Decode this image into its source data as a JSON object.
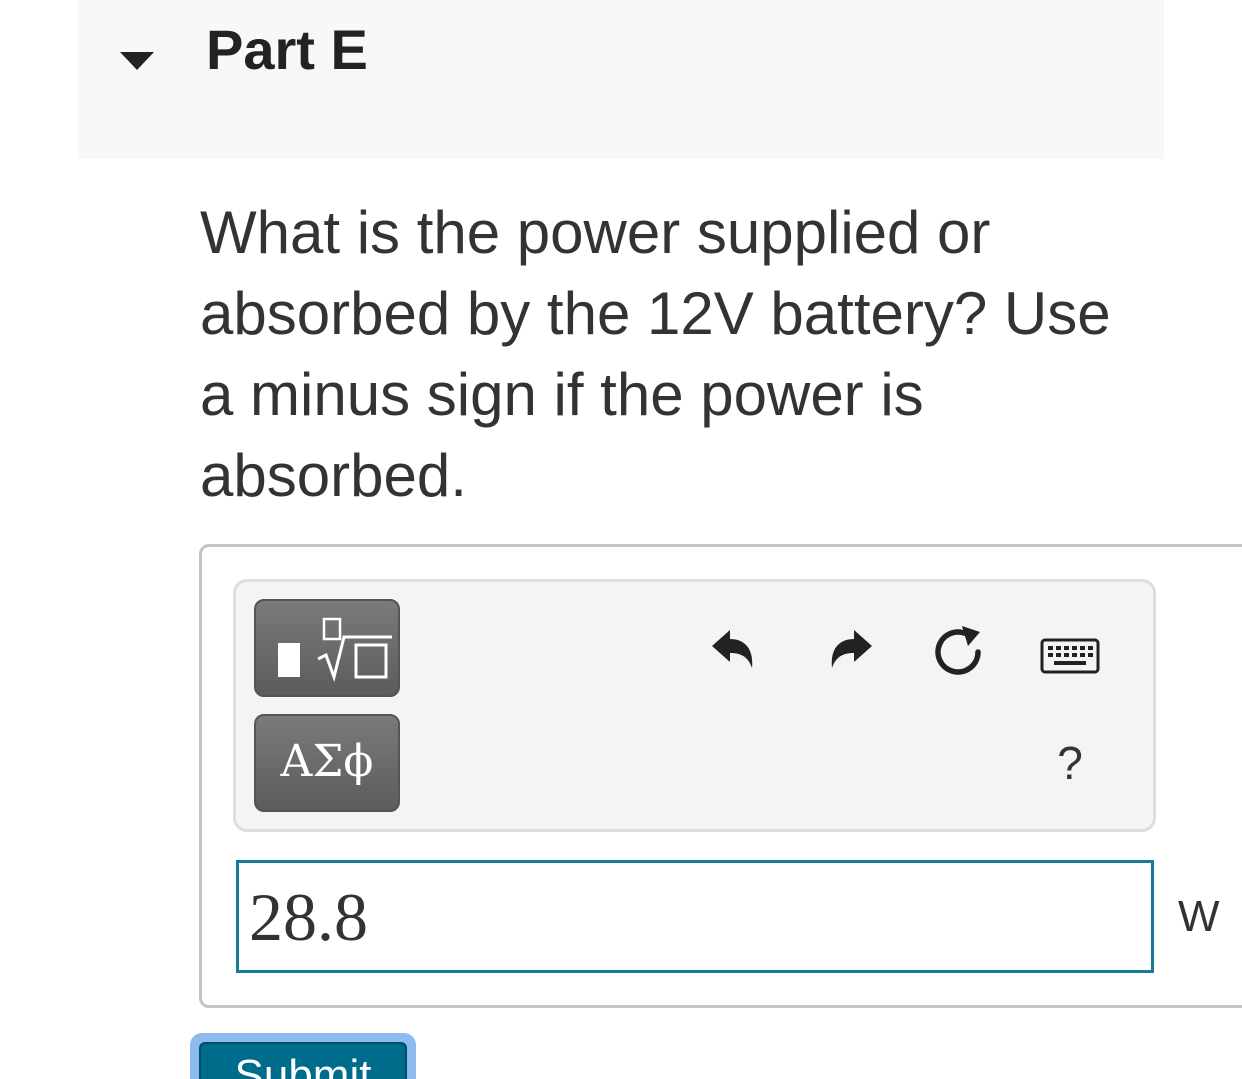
{
  "part": {
    "title": "Part E",
    "toggle_icon": "caret-down-icon",
    "header_bg": "#f8f8f8"
  },
  "question": {
    "text": "What is the power supplied or absorbed by the 12V battery? Use a minus sign if the power is absorbed."
  },
  "toolbar": {
    "templates_icon": "templates-sqrt-icon",
    "symbols_label": "ΑΣϕ",
    "undo_icon": "undo-icon",
    "redo_icon": "redo-icon",
    "reset_icon": "reset-icon",
    "keyboard_icon": "keyboard-icon",
    "help_label": "?"
  },
  "answer": {
    "value": "28.8",
    "unit": "W",
    "border_color": "#1a7a9a"
  },
  "submit": {
    "label": "Submit",
    "bg": "#006c8c"
  }
}
